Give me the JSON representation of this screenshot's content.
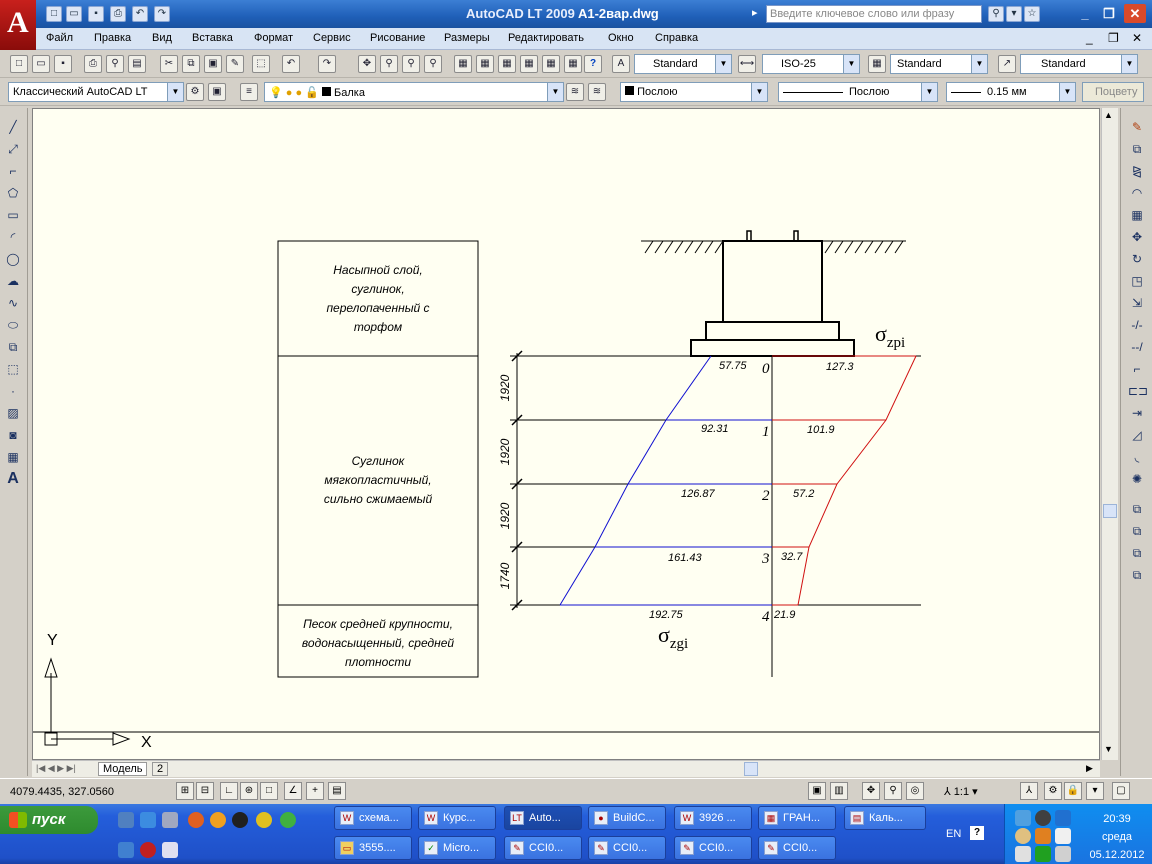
{
  "window": {
    "app_title": "AutoCAD LT 2009",
    "file_name": "A1-2вар.dwg",
    "search_placeholder": "Введите ключевое слово или фразу"
  },
  "menu": [
    "Файл",
    "Правка",
    "Вид",
    "Вставка",
    "Формат",
    "Сервис",
    "Рисование",
    "Размеры",
    "Редактировать",
    "Окно",
    "Справка"
  ],
  "toolbar_styles": {
    "text_style": "Standard",
    "dim_style": "ISO-25",
    "table_style": "Standard",
    "multileader_style": "Standard"
  },
  "toolbar_layers": {
    "workspace": "Классический AutoCAD LT",
    "layer": "Балка",
    "color": "Послою",
    "linetype": "Послою",
    "lineweight": "0.15 мм",
    "plot_style": "Поцвету"
  },
  "drawing": {
    "soil_layers": [
      [
        "Насыпной слой,",
        "суглинок,",
        "перелопаченный с",
        "торфом"
      ],
      [
        "Суглинок",
        "мягкопластичный,",
        "сильно сжимаемый"
      ],
      [
        "Песок средней крупности,",
        "водонасыщенный, средней",
        "плотности"
      ]
    ],
    "dimensions": [
      "1920",
      "1920",
      "1920",
      "1740"
    ],
    "points": [
      "0",
      "1",
      "2",
      "3",
      "4"
    ],
    "sigma_zg": [
      "57.75",
      "92.31",
      "126.87",
      "161.43",
      "192.75"
    ],
    "sigma_zp": [
      "127.3",
      "101.9",
      "57.2",
      "32.7",
      "21.9"
    ],
    "label_zp": {
      "sigma": "σ",
      "sub": "zpi"
    },
    "label_zg": {
      "sigma": "σ",
      "sub": "zgi"
    },
    "ucs_x": "X",
    "ucs_y": "Y",
    "colors": {
      "zg_line": "#1010d0",
      "zp_line": "#d01010",
      "ink": "#000000"
    }
  },
  "layout_tabs": [
    "Модель",
    "2"
  ],
  "status": {
    "coordinates": "4079.4435, 327.0560",
    "scale": "1:1"
  },
  "taskbar": {
    "start_label": "пуск",
    "buttons_row1": [
      "схема...",
      "Курс...",
      "Auto...",
      "BuildC...",
      "3926 ...",
      "ГРАН...",
      "Каль..."
    ],
    "buttons_row2": [
      "3555....",
      "Micro...",
      "CCI0...",
      "CCI0...",
      "CCI0...",
      "CCI0..."
    ],
    "language": "EN",
    "time": "20:39",
    "weekday": "среда",
    "date": "05.12.2012"
  }
}
